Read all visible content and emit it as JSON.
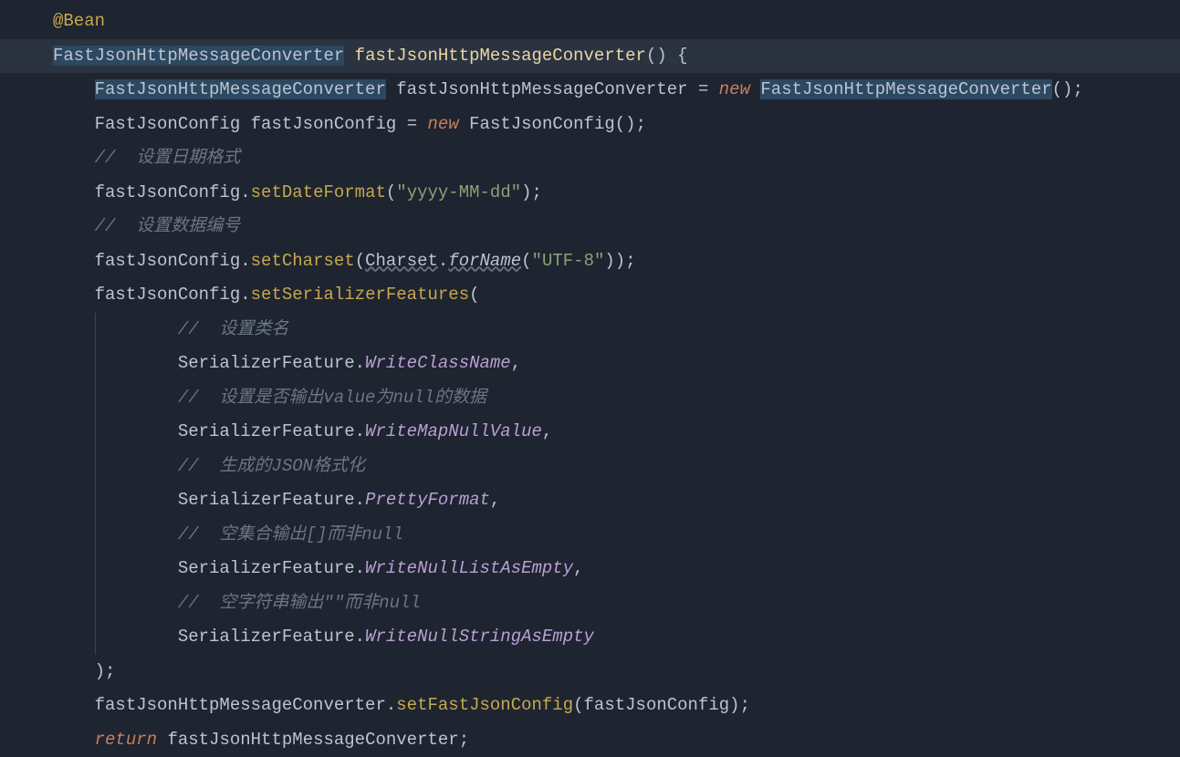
{
  "code": {
    "annotation": "@Bean",
    "returnType": "FastJsonHttpMessageConverter",
    "methodName": "fastJsonHttpMessageConverter",
    "line3": {
      "type": "FastJsonHttpMessageConverter",
      "var": "fastJsonHttpMessageConverter",
      "kw": "new",
      "ctor": "FastJsonHttpMessageConverter"
    },
    "line4": {
      "type": "FastJsonConfig",
      "var": "fastJsonConfig",
      "kw": "new",
      "ctor": "FastJsonConfig"
    },
    "comment1": "//  设置日期格式",
    "line6": {
      "obj": "fastJsonConfig",
      "method": "setDateFormat",
      "arg": "\"yyyy-MM-dd\""
    },
    "comment2": "//  设置数据编号",
    "line8": {
      "obj": "fastJsonConfig",
      "method": "setCharset",
      "clazz": "Charset",
      "staticMethod": "forName",
      "arg": "\"UTF-8\""
    },
    "line9": {
      "obj": "fastJsonConfig",
      "method": "setSerializerFeatures"
    },
    "comment3": "//  设置类名",
    "sf": "SerializerFeature",
    "val1": "WriteClassName",
    "comment4": "//  设置是否输出value为null的数据",
    "val2": "WriteMapNullValue",
    "comment5": "//  生成的JSON格式化",
    "val3": "PrettyFormat",
    "comment6": "//  空集合输出[]而非null",
    "val4": "WriteNullListAsEmpty",
    "comment7": "//  空字符串输出\"\"而非null",
    "val5": "WriteNullStringAsEmpty",
    "line21": {
      "obj": "fastJsonHttpMessageConverter",
      "method": "setFastJsonConfig",
      "arg": "fastJsonConfig"
    },
    "returnKw": "return",
    "returnVar": "fastJsonHttpMessageConverter"
  }
}
